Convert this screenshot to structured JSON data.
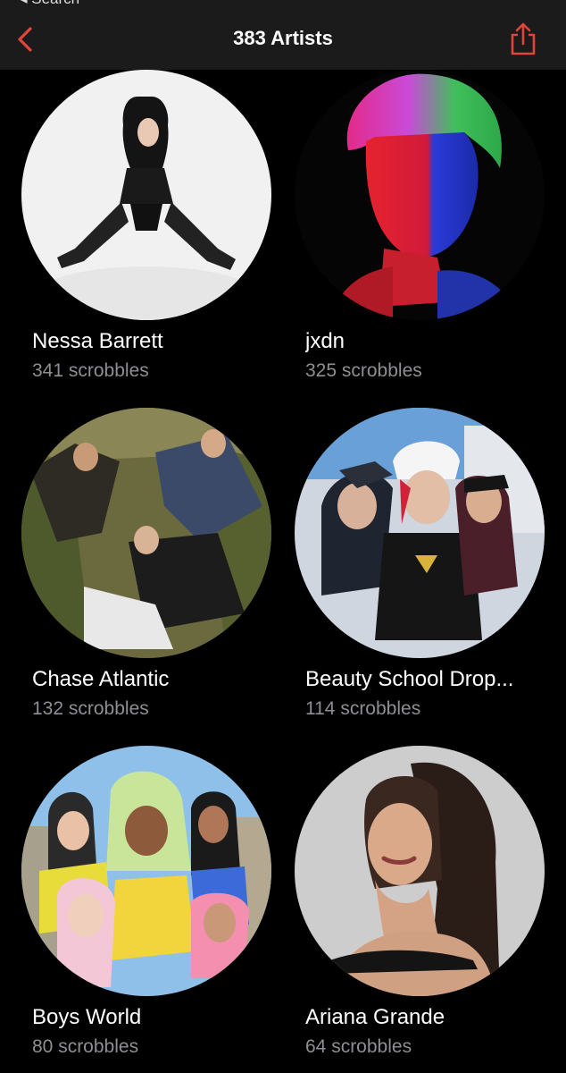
{
  "status_bar": {
    "back_label": "◂ Search"
  },
  "nav": {
    "title": "383 Artists",
    "back_icon": "chevron-left-icon",
    "share_icon": "share-icon",
    "accent_color": "#e0453a"
  },
  "artists": [
    {
      "name": "Nessa Barrett",
      "scrobbles": "341 scrobbles"
    },
    {
      "name": "jxdn",
      "scrobbles": "325 scrobbles"
    },
    {
      "name": "Chase Atlantic",
      "scrobbles": "132 scrobbles"
    },
    {
      "name": "Beauty School Drop...",
      "scrobbles": "114 scrobbles"
    },
    {
      "name": "Boys World",
      "scrobbles": "80 scrobbles"
    },
    {
      "name": "Ariana Grande",
      "scrobbles": "64 scrobbles"
    }
  ]
}
